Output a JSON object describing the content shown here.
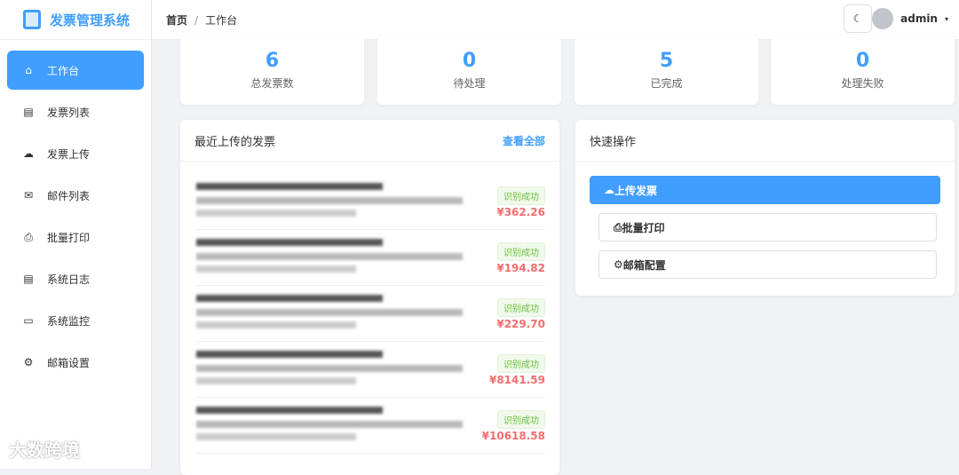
{
  "app": {
    "title": "发票管理系统"
  },
  "sidebar": {
    "items": [
      {
        "label": "工作台",
        "icon": "home-icon"
      },
      {
        "label": "发票列表",
        "icon": "document-icon"
      },
      {
        "label": "发票上传",
        "icon": "cloud-upload-icon"
      },
      {
        "label": "邮件列表",
        "icon": "mail-icon"
      },
      {
        "label": "批量打印",
        "icon": "printer-icon"
      },
      {
        "label": "系统日志",
        "icon": "document-icon"
      },
      {
        "label": "系统监控",
        "icon": "monitor-icon"
      },
      {
        "label": "邮箱设置",
        "icon": "gear-icon"
      }
    ]
  },
  "header": {
    "breadcrumb": [
      "首页",
      "工作台"
    ],
    "user": "admin"
  },
  "stats": [
    {
      "value": "6",
      "label": "总发票数"
    },
    {
      "value": "0",
      "label": "待处理"
    },
    {
      "value": "5",
      "label": "已完成"
    },
    {
      "value": "0",
      "label": "处理失败"
    }
  ],
  "recent": {
    "title": "最近上传的发票",
    "view_all": "查看全部",
    "items": [
      {
        "status": "识别成功",
        "amount": "¥362.26"
      },
      {
        "status": "识别成功",
        "amount": "¥194.82"
      },
      {
        "status": "识别成功",
        "amount": "¥229.70"
      },
      {
        "status": "识别成功",
        "amount": "¥8141.59"
      },
      {
        "status": "识别成功",
        "amount": "¥10618.58"
      }
    ]
  },
  "quick": {
    "title": "快速操作",
    "upload": "上传发票",
    "print": "批量打印",
    "mail": "邮箱配置"
  },
  "watermark": "大数跨境",
  "colors": {
    "primary": "#409eff",
    "success": "#67c23a",
    "danger": "#f56c6c"
  }
}
